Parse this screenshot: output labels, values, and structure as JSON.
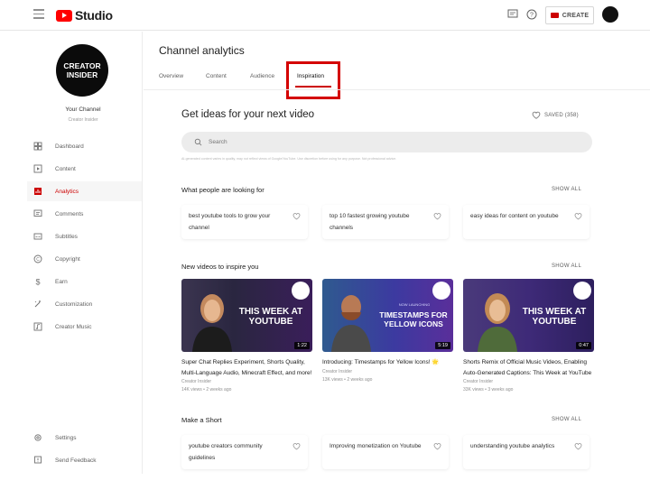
{
  "app": {
    "logo_text": "Studio",
    "create_label": "CREATE"
  },
  "channel": {
    "avatar_text_line1": "CREATOR",
    "avatar_text_line2": "INSIDER",
    "name": "Your Channel",
    "subtitle": "Creator Insider"
  },
  "sidebar": {
    "items": [
      {
        "label": "Dashboard",
        "icon": "dashboard-icon"
      },
      {
        "label": "Content",
        "icon": "content-icon"
      },
      {
        "label": "Analytics",
        "icon": "analytics-icon",
        "active": true
      },
      {
        "label": "Comments",
        "icon": "comments-icon"
      },
      {
        "label": "Subtitles",
        "icon": "subtitles-icon"
      },
      {
        "label": "Copyright",
        "icon": "copyright-icon"
      },
      {
        "label": "Earn",
        "icon": "earn-icon"
      },
      {
        "label": "Customization",
        "icon": "customization-icon"
      },
      {
        "label": "Creator Music",
        "icon": "music-icon"
      }
    ],
    "bottom": [
      {
        "label": "Settings",
        "icon": "settings-icon"
      },
      {
        "label": "Send Feedback",
        "icon": "feedback-icon"
      }
    ]
  },
  "page": {
    "title": "Channel analytics",
    "tabs": [
      "Overview",
      "Content",
      "Audience",
      "Inspiration"
    ],
    "active_tab": "Inspiration"
  },
  "inspiration": {
    "heading": "Get ideas for your next video",
    "saved_label": "SAVED (358)",
    "search_placeholder": "Search",
    "disclaimer": "AI-generated content varies in quality, may not reflect views of Google/YouTube. Use discretion before using for any purpose. Not professional advice.",
    "show_all": "SHOW ALL",
    "looking_for": {
      "title": "What people are looking for",
      "cards": [
        "best youtube tools to grow your channel",
        "top 10 fastest growing youtube channels",
        "easy ideas for content on youtube"
      ]
    },
    "new_videos": {
      "title": "New videos to inspire you",
      "videos": [
        {
          "thumb_text": "THIS WEEK AT YOUTUBE",
          "duration": "1:22",
          "title": "Super Chat Replies Experiment, Shorts Quality, Multi-Language Audio, Minecraft Effect, and more!",
          "channel": "Creator Insider",
          "meta": "14K views • 2 weeks ago"
        },
        {
          "thumb_kicker": "NOW LAUNCHING",
          "thumb_text": "TIMESTAMPS FOR YELLOW ICONS",
          "duration": "5:19",
          "title": "Introducing: Timestamps for Yellow Icons! 🌟",
          "channel": "Creator Insider",
          "meta": "13K views • 2 weeks ago"
        },
        {
          "thumb_text": "THIS WEEK AT YOUTUBE",
          "duration": "0:47",
          "title": "Shorts Remix of Official Music Videos, Enabling Auto-Generated Captions: This Week at YouTube",
          "channel": "Creator Insider",
          "meta": "33K views • 3 weeks ago"
        }
      ]
    },
    "shorts": {
      "title": "Make a Short",
      "cards": [
        "youtube creators community guidelines",
        "Improving monetization on Youtube",
        "understanding youtube analytics"
      ]
    }
  },
  "colors": {
    "accent": "#cc0000",
    "brand": "#ff0000",
    "highlight": "#d40000"
  }
}
